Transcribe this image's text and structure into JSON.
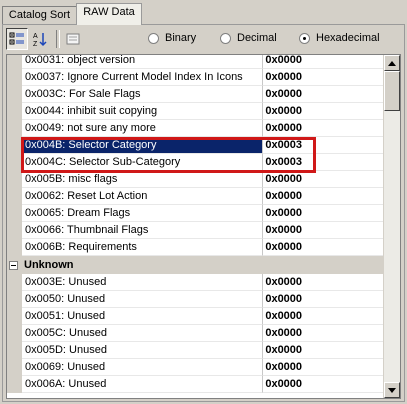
{
  "tabs": [
    {
      "label": "Catalog Sort"
    },
    {
      "label": "RAW Data"
    }
  ],
  "format_options": [
    {
      "label": "Binary",
      "checked": false
    },
    {
      "label": "Decimal",
      "checked": false
    },
    {
      "label": "Hexadecimal",
      "checked": true
    }
  ],
  "rows_top": [
    {
      "name": "0x0031: object version",
      "value": "0x0000"
    },
    {
      "name": "0x0037: Ignore Current Model Index In Icons",
      "value": "0x0000"
    },
    {
      "name": "0x003C: For Sale Flags",
      "value": "0x0000"
    },
    {
      "name": "0x0044: inhibit suit copying",
      "value": "0x0000"
    },
    {
      "name": "0x0049: not sure any more",
      "value": "0x0000"
    },
    {
      "name": "0x004B: Selector Category",
      "value": "0x0003"
    },
    {
      "name": "0x004C: Selector Sub-Category",
      "value": "0x0003"
    },
    {
      "name": "0x005B: misc flags",
      "value": "0x0000"
    },
    {
      "name": "0x0062: Reset Lot Action",
      "value": "0x0000"
    },
    {
      "name": "0x0065: Dream Flags",
      "value": "0x0000"
    },
    {
      "name": "0x0066: Thumbnail Flags",
      "value": "0x0000"
    },
    {
      "name": "0x006B: Requirements",
      "value": "0x0000"
    }
  ],
  "category": {
    "label": "Unknown"
  },
  "rows_unknown": [
    {
      "name": "0x003E: Unused",
      "value": "0x0000"
    },
    {
      "name": "0x0050: Unused",
      "value": "0x0000"
    },
    {
      "name": "0x0051: Unused",
      "value": "0x0000"
    },
    {
      "name": "0x005C: Unused",
      "value": "0x0000"
    },
    {
      "name": "0x005D: Unused",
      "value": "0x0000"
    },
    {
      "name": "0x0069: Unused",
      "value": "0x0000"
    },
    {
      "name": "0x006A: Unused",
      "value": "0x0000"
    }
  ],
  "colors": {
    "selection": "#0a246a",
    "annotation": "#d01818"
  }
}
